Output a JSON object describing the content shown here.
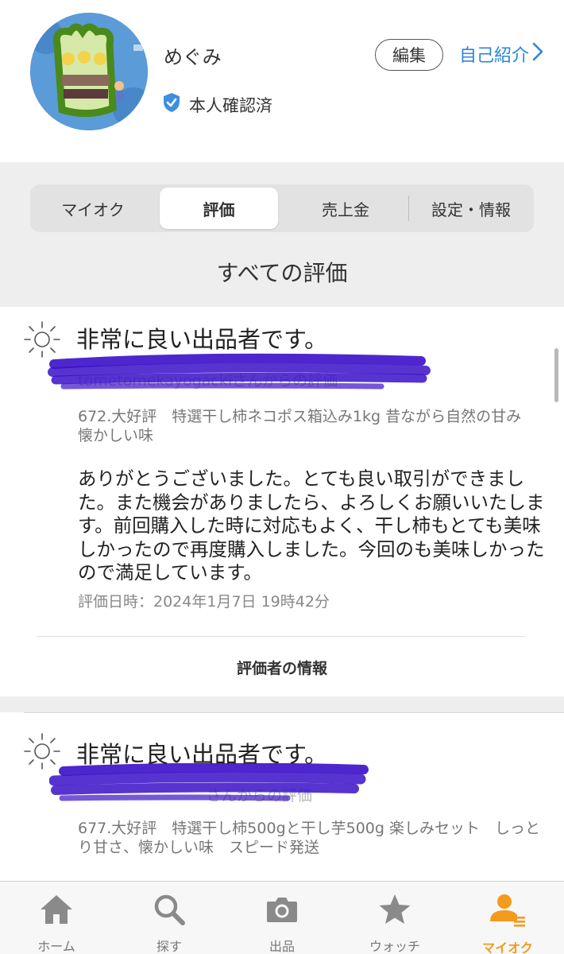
{
  "profile": {
    "name": "めぐみ",
    "verified_label": "本人確認済",
    "edit_label": "編集",
    "intro_label": "自己紹介"
  },
  "tabs": [
    {
      "label": "マイオク",
      "active": false
    },
    {
      "label": "評価",
      "active": true
    },
    {
      "label": "売上金",
      "active": false
    },
    {
      "label": "設定・情報",
      "active": false
    }
  ],
  "section_title": "すべての評価",
  "reviews": [
    {
      "rating": "非常に良い出品者です。",
      "reviewer": "tometomekayogackiさんからの評価",
      "item": "672.大好評　特選干し柿ネコポス箱込み1kg 昔ながら自然の甘み　懐かしい味",
      "comment": "ありがとうございました。とても良い取引ができました。また機会がありましたら、よろしくお願いいたします。前回購入した時に対応もよく、干し柿もとても美味しかったので再度購入しました。今回のも美味しかったので満足しています。",
      "date": "評価日時：2024年1月7日 19時42分",
      "info_label": "評価者の情報"
    },
    {
      "rating": "非常に良い出品者です。",
      "reviewer": "さんからの評価",
      "item": "677.大好評　特選干し柿500gと干し芋500g 楽しみセット　しっとり甘さ、懐かしい味　スピード発送"
    }
  ],
  "bottom_nav": [
    {
      "label": "ホーム",
      "icon": "home-icon",
      "active": false
    },
    {
      "label": "探す",
      "icon": "search-icon",
      "active": false
    },
    {
      "label": "出品",
      "icon": "camera-icon",
      "active": false
    },
    {
      "label": "ウォッチ",
      "icon": "star-icon",
      "active": false
    },
    {
      "label": "マイオク",
      "icon": "person-list-icon",
      "active": true
    }
  ],
  "colors": {
    "accent_orange": "#f29b1d",
    "link_blue": "#2b87d9",
    "redaction_purple": "#3a10c8"
  }
}
